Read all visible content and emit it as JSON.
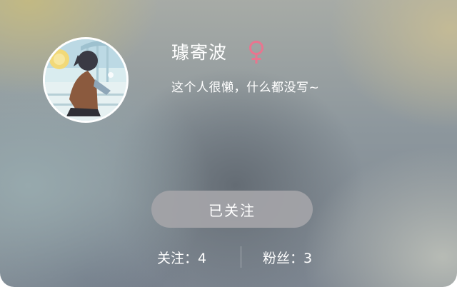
{
  "profile": {
    "username": "璩寄波",
    "gender_icon": "female-symbol-icon",
    "bio": "这个人很懒，什么都没写~",
    "avatar": "anime-avatar-image"
  },
  "actions": {
    "follow_label": "已关注"
  },
  "stats": {
    "following": "关注：4",
    "followers": "粉丝：3"
  },
  "colors": {
    "gender_pink": "#e8758f",
    "button_bg": "#a4a4a8",
    "text": "#ffffff"
  }
}
